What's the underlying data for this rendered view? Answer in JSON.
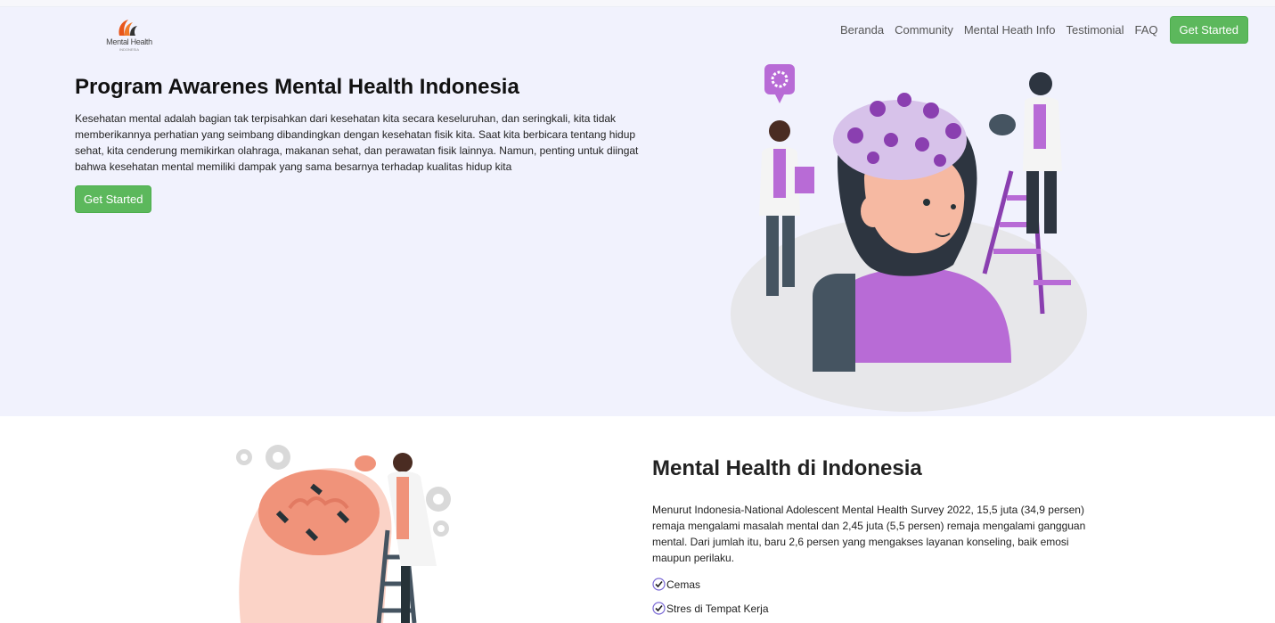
{
  "header": {
    "logo_text": "Mental Health",
    "logo_subtext": "INDONESIA",
    "nav": [
      "Beranda",
      "Community",
      "Mental Heath Info",
      "Testimonial",
      "FAQ"
    ],
    "cta_label": "Get Started"
  },
  "hero": {
    "title": "Program Awarenes Mental Health Indonesia",
    "description": "Kesehatan mental adalah bagian tak terpisahkan dari kesehatan kita secara keseluruhan, dan seringkali, kita tidak memberikannya perhatian yang seimbang dibandingkan dengan kesehatan fisik kita. Saat kita berbicara tentang hidup sehat, kita cenderung memikirkan olahraga, makanan sehat, dan perawatan fisik lainnya. Namun, penting untuk diingat bahwa kesehatan mental memiliki dampak yang sama besarnya terhadap kualitas hidup kita",
    "button_label": "Get Started"
  },
  "section": {
    "title": "Mental Health di Indonesia",
    "description": "Menurut Indonesia-National Adolescent Mental Health Survey 2022, 15,5 juta (34,9 persen) remaja mengalami masalah mental dan 2,45 juta (5,5 persen) remaja mengalami gangguan mental. Dari jumlah itu, baru 2,6 persen yang mengakses layanan konseling, baik emosi maupun perilaku.",
    "list": [
      "Cemas",
      "Stres di Tempat Kerja"
    ]
  },
  "colors": {
    "hero_bg": "#f1f2fd",
    "accent_green": "#5cb85c",
    "purple": "#b06ad0",
    "coral": "#f4a08f"
  },
  "icons": [
    "logo-mark-icon",
    "check-circle-icon",
    "gear-icon"
  ]
}
